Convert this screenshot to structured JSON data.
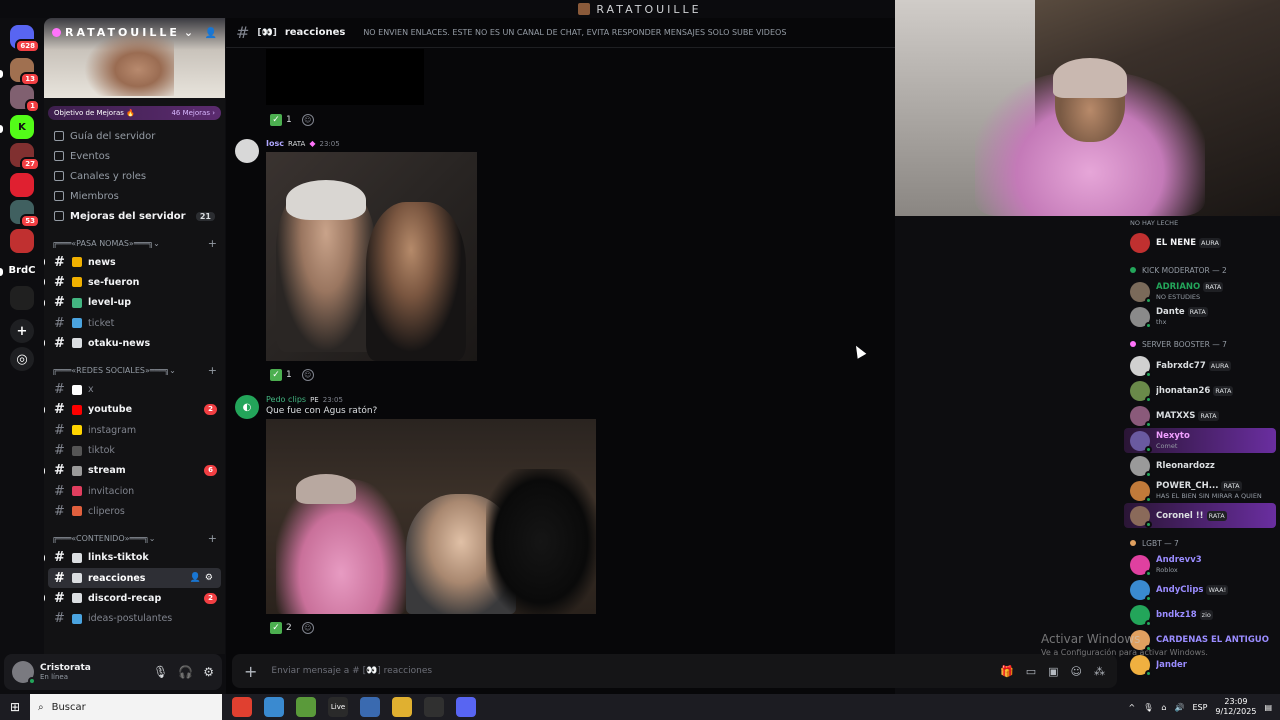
{
  "window": {
    "title": "RATATOUILLE"
  },
  "rail": {
    "items": [
      {
        "name": "discord-home",
        "badge": "628",
        "color": "#5865f2"
      },
      {
        "name": "server-1",
        "badge": "13",
        "color": "#a07050"
      },
      {
        "name": "server-2",
        "badge": "1",
        "color": "#806070"
      },
      {
        "name": "kick",
        "badge": "",
        "color": "#53fc18",
        "label": "K"
      },
      {
        "name": "server-3",
        "badge": "27",
        "color": "#803030"
      },
      {
        "name": "server-4",
        "badge": "",
        "color": "#e02030"
      },
      {
        "name": "server-5",
        "badge": "53",
        "color": "#406060"
      },
      {
        "name": "server-6",
        "badge": "",
        "color": "#c03030"
      },
      {
        "name": "brdc",
        "badge": "",
        "color": "#0d0d10",
        "label": "BrdC"
      },
      {
        "name": "server-7",
        "badge": "",
        "color": "#202020"
      }
    ]
  },
  "server": {
    "name": "RATATOUILLE",
    "goal_label": "Objetivo de Mejoras 🔥",
    "goal_count": "46 Mejoras ›",
    "nav": [
      {
        "label": "Guía del servidor",
        "bold": false,
        "count": ""
      },
      {
        "label": "Eventos",
        "bold": false,
        "count": ""
      },
      {
        "label": "Canales y roles",
        "bold": false,
        "count": ""
      },
      {
        "label": "Miembros",
        "bold": false,
        "count": ""
      },
      {
        "label": "Mejoras del servidor",
        "bold": true,
        "count": "21"
      }
    ]
  },
  "categories": [
    {
      "label": "╔═══«PASA NOMAS»═══╗",
      "channels": [
        {
          "name": "news",
          "emoji_color": "#f0b000",
          "unread": true,
          "mention": ""
        },
        {
          "name": "se-fueron",
          "emoji_color": "#f0b000",
          "unread": true,
          "mention": ""
        },
        {
          "name": "level-up",
          "emoji_color": "#43b581",
          "unread": true,
          "mention": ""
        },
        {
          "name": "ticket",
          "emoji_color": "#4aa3df",
          "unread": false,
          "mention": ""
        },
        {
          "name": "otaku-news",
          "emoji_color": "#dbdee1",
          "unread": true,
          "mention": ""
        }
      ]
    },
    {
      "label": "╔═══«REDES SOCIALES»═══╗",
      "channels": [
        {
          "name": "x",
          "emoji_color": "#ffffff",
          "unread": false,
          "mention": ""
        },
        {
          "name": "youtube",
          "emoji_color": "#ff0000",
          "unread": true,
          "mention": "2"
        },
        {
          "name": "instagram",
          "emoji_color": "#ffd400",
          "unread": false,
          "mention": ""
        },
        {
          "name": "tiktok",
          "emoji_color": "#555555",
          "unread": false,
          "mention": ""
        },
        {
          "name": "stream",
          "emoji_color": "#9a9a9a",
          "unread": true,
          "mention": "6"
        },
        {
          "name": "invitacion",
          "emoji_color": "#e03e5e",
          "unread": false,
          "mention": ""
        },
        {
          "name": "cliperos",
          "emoji_color": "#e0603e",
          "unread": false,
          "mention": ""
        }
      ]
    },
    {
      "label": "╔═══«CONTENIDO»═══╗",
      "channels": [
        {
          "name": "links-tiktok",
          "emoji_color": "#dbdee1",
          "unread": true,
          "mention": ""
        },
        {
          "name": "reacciones",
          "emoji_color": "#dbdee1",
          "unread": true,
          "mention": "",
          "active": true
        },
        {
          "name": "discord-recap",
          "emoji_color": "#dbdee1",
          "unread": true,
          "mention": "2"
        },
        {
          "name": "ideas-postulantes",
          "emoji_color": "#4aa3df",
          "unread": false,
          "mention": ""
        }
      ]
    }
  ],
  "user": {
    "name": "Cristorata",
    "status": "En línea"
  },
  "channel": {
    "emoji": "[👀]",
    "name": "reacciones",
    "topic": "NO ENVIEN ENLACES. ESTE NO ES UN CANAL DE CHAT, EVITA RESPONDER MENSAJES SOLO SUBE VIDEOS"
  },
  "messages": [
    {
      "author": "Iosc",
      "role": "RATA",
      "time": "23:05",
      "text": "",
      "reaction_count": "1"
    },
    {
      "author": "Pedo clips",
      "role": "PE",
      "time": "23:05",
      "text": "Que fue con Agus ratón?",
      "reaction_count": "2"
    }
  ],
  "top_reaction_count": "1",
  "composer": {
    "placeholder": "Enviar mensaje a # [👀] reacciones"
  },
  "members": {
    "top_item": {
      "sub": "NO HAY LECHE"
    },
    "el_nene": {
      "name": "EL NENE",
      "tag": "AURA"
    },
    "groups": [
      {
        "label": "KICK MODERATOR — 2",
        "dot": "#23a55a",
        "items": [
          {
            "name": "ADRIANO",
            "tag": "RATA",
            "sub": "NO ESTUDIES",
            "color": "#23a55a"
          },
          {
            "name": "Dante",
            "tag": "RATA",
            "sub": "thx",
            "color": "#dbdee1"
          }
        ]
      },
      {
        "label": "SERVER BOOSTER — 7",
        "dot": "#ff73fa",
        "items": [
          {
            "name": "Fabrxdc77",
            "tag": "AURA",
            "sub": "",
            "color": "#dbdee1"
          },
          {
            "name": "jhonatan26",
            "tag": "RATA",
            "sub": "",
            "color": "#dbdee1"
          },
          {
            "name": "MATXXS",
            "tag": "RATA",
            "sub": "",
            "color": "#dbdee1"
          },
          {
            "name": "Nexyto",
            "tag": "",
            "sub": "Comet",
            "color": "#f0a0ff",
            "hl": true
          },
          {
            "name": "Rleonardozz",
            "tag": "",
            "sub": "",
            "color": "#dbdee1"
          },
          {
            "name": "POWER_CH...",
            "tag": "RATA",
            "sub": "HAS EL BIEN SIN MIRAR A QUIEN",
            "color": "#dbdee1"
          },
          {
            "name": "Coronel !!",
            "tag": "RATA",
            "sub": "",
            "color": "#dbdee1",
            "hl": true
          }
        ]
      },
      {
        "label": "LGBT — 7",
        "dot": "#e0a060",
        "items": [
          {
            "name": "Andrevv3",
            "tag": "",
            "sub": "Roblox",
            "color": "#9a8cff"
          },
          {
            "name": "AndyClips",
            "tag": "WAA!",
            "sub": "",
            "color": "#9a8cff"
          },
          {
            "name": "bndkz18",
            "tag": "zio",
            "sub": "",
            "color": "#9a8cff"
          },
          {
            "name": "CARDENAS EL ANTIGUO",
            "tag": "",
            "sub": "",
            "color": "#9a8cff"
          },
          {
            "name": "Jander",
            "tag": "",
            "sub": "",
            "color": "#9a8cff"
          }
        ]
      }
    ]
  },
  "watermark": {
    "line1": "Activar Windows",
    "line2": "Ve a Configuración para activar Windows."
  },
  "taskbar": {
    "search": "Buscar",
    "lang": "ESP",
    "time": "23:09",
    "date": "9/12/2025",
    "apps": [
      "chrome",
      "copilot",
      "app-3",
      "live",
      "notepad",
      "explorer",
      "obs",
      "discord"
    ]
  }
}
